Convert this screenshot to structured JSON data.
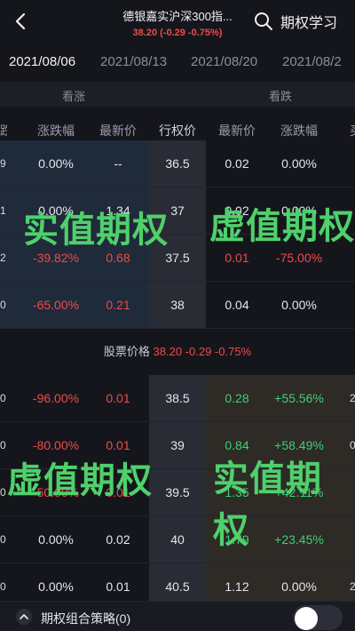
{
  "header": {
    "title": "德银嘉实沪深300指...",
    "subtitle": "38.20 (-0.29 -0.75%)",
    "learn_label": "期权学习"
  },
  "date_tabs": [
    "2021/08/06",
    "2021/08/13",
    "2021/08/20",
    "2021/08/2"
  ],
  "sections": {
    "call": "看涨",
    "put": "看跌"
  },
  "columns": {
    "change_pct_call": "涨跌幅",
    "last_call": "最新价",
    "strike": "行权价",
    "last_put": "最新价",
    "change_pct_put": "涨跌幅",
    "left_edge": "跌",
    "right_edge": "买"
  },
  "rows_top": [
    {
      "edge": "9",
      "c_chg": "0.00%",
      "c_last": "--",
      "strike": "36.5",
      "p_last": "0.02",
      "p_chg": "0.00%",
      "edge_r": ""
    },
    {
      "edge": "1",
      "c_chg": "0.00%",
      "c_last": "1.34",
      "strike": "37",
      "p_last": "0.02",
      "p_chg": "0.00%",
      "edge_r": ""
    },
    {
      "edge": "2",
      "c_chg": "-39.82%",
      "c_last": "0.68",
      "strike": "37.5",
      "p_last": "0.01",
      "p_chg": "-75.00%",
      "edge_r": ""
    },
    {
      "edge": "0",
      "c_chg": "-65.00%",
      "c_last": "0.21",
      "strike": "38",
      "p_last": "0.04",
      "p_chg": "0.00%",
      "edge_r": ""
    }
  ],
  "stock_price": {
    "label": "股票价格",
    "value": "38.20 -0.29 -0.75%"
  },
  "rows_bottom": [
    {
      "edge": "0",
      "c_chg": "-96.00%",
      "c_last": "0.01",
      "strike": "38.5",
      "p_last": "0.28",
      "p_chg": "+55.56%",
      "edge_r": "2"
    },
    {
      "edge": "0",
      "c_chg": "-80.00%",
      "c_last": "0.01",
      "strike": "39",
      "p_last": "0.84",
      "p_chg": "+58.49%",
      "edge_r": "0"
    },
    {
      "edge": "0",
      "c_chg": "-50.00%",
      "c_last": "0.01",
      "strike": "39.5",
      "p_last": "1.35",
      "p_chg": "+42.11%",
      "edge_r": ""
    },
    {
      "edge": "0",
      "c_chg": "0.00%",
      "c_last": "0.02",
      "strike": "40",
      "p_last": "1.79",
      "p_chg": "+23.45%",
      "edge_r": ""
    },
    {
      "edge": "0",
      "c_chg": "0.00%",
      "c_last": "0.01",
      "strike": "40.5",
      "p_last": "1.12",
      "p_chg": "0.00%",
      "edge_r": "2"
    }
  ],
  "overlays": {
    "top_left": "实值期权",
    "top_right": "虚值期权",
    "bottom_left": "虚值期权",
    "bottom_right": "实值期权"
  },
  "bottom_bar": {
    "label": "期权组合策略(0)"
  },
  "colors": {
    "up": "#ef4a4a",
    "down": "#3fcf75",
    "accent": "#4fd06b"
  }
}
